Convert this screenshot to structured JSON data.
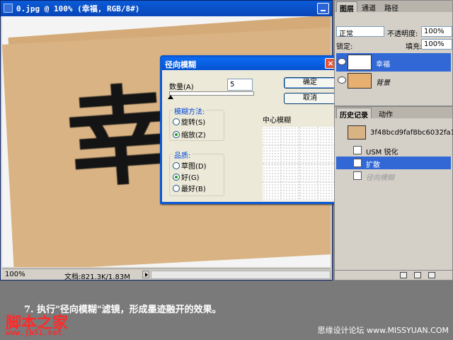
{
  "document": {
    "title": "0.jpg @ 100% (幸福, RGB/8#)",
    "canvas_text": "幸",
    "status": {
      "zoom": "100%",
      "doc_size": "文档:821.3K/1.83M"
    }
  },
  "dialog": {
    "title": "径向模糊",
    "amount_label": "数量(A)",
    "amount_value": "5",
    "ok_label": "确定",
    "cancel_label": "取消",
    "method_group": "模糊方法:",
    "method_options": [
      "旋转(S)",
      "缩放(Z)"
    ],
    "method_selected": "缩放(Z)",
    "quality_group": "品质:",
    "quality_options": [
      "草图(D)",
      "好(G)",
      "最好(B)"
    ],
    "quality_selected": "好(G)",
    "center_label": "中心模糊"
  },
  "layers_panel": {
    "tabs": [
      "图层",
      "通道",
      "路径"
    ],
    "blend_mode": "正常",
    "opacity_label": "不透明度:",
    "opacity_value": "100%",
    "lock_label": "锁定:",
    "fill_label": "填充:",
    "fill_value": "100%",
    "layers": [
      {
        "name": "幸福",
        "selected": true
      },
      {
        "name": "背景",
        "selected": false
      }
    ]
  },
  "history_panel": {
    "tabs": [
      "历史记录",
      "动作"
    ],
    "snapshot": "3f48bcd9faf8bc6032fa1...",
    "items": [
      {
        "name": "USM 锐化",
        "selected": false
      },
      {
        "name": "扩散",
        "selected": true
      },
      {
        "name": "径向模糊",
        "selected": false
      }
    ]
  },
  "caption": {
    "text": "7. 执行\"径向模糊\"滤镜，形成墨迹融开的效果。",
    "watermark_left": "脚本之家",
    "watermark_url": "www.jb51.net",
    "watermark_right": "思缘设计论坛 www.MISSYUAN.COM"
  }
}
